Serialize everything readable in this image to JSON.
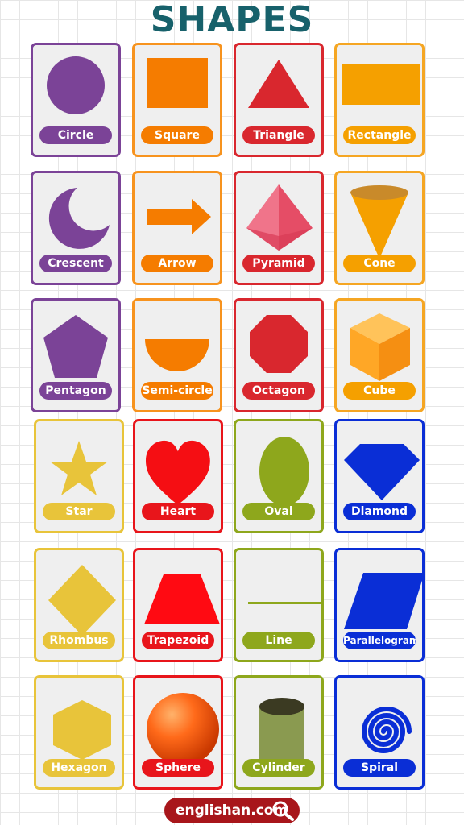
{
  "title": "SHAPES",
  "footer_text": "englishan.com",
  "footer_icon": "magnifier-icon",
  "colors": {
    "purple": "#7b4397",
    "orange": "#f7931e",
    "red": "#d9272e",
    "yellow": "#e8c43a",
    "green": "#8ea71c",
    "blue": "#0a2ed6",
    "title": "#17616b",
    "footer": "#a8161b"
  },
  "shapes": [
    {
      "label": "Circle"
    },
    {
      "label": "Square"
    },
    {
      "label": "Triangle"
    },
    {
      "label": "Rectangle"
    },
    {
      "label": "Crescent"
    },
    {
      "label": "Arrow"
    },
    {
      "label": "Pyramid"
    },
    {
      "label": "Cone"
    },
    {
      "label": "Pentagon"
    },
    {
      "label": "Semi-circle"
    },
    {
      "label": "Octagon"
    },
    {
      "label": "Cube"
    },
    {
      "label": "Star"
    },
    {
      "label": "Heart"
    },
    {
      "label": "Oval"
    },
    {
      "label": "Diamond"
    },
    {
      "label": "Rhombus"
    },
    {
      "label": "Trapezoid"
    },
    {
      "label": "Line"
    },
    {
      "label": "Parallelogram"
    },
    {
      "label": "Hexagon"
    },
    {
      "label": "Sphere"
    },
    {
      "label": "Cylinder"
    },
    {
      "label": "Spiral"
    }
  ]
}
